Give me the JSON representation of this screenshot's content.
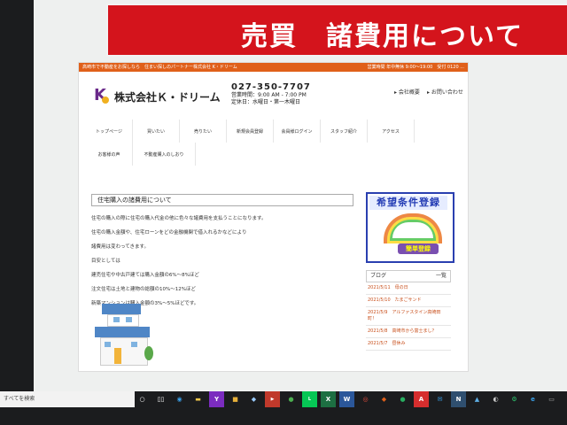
{
  "banner": {
    "title": "売買　諸費用について"
  },
  "site": {
    "topbar": {
      "left": "高崎市で不動産をお探しなら　住まい探しのパートナー株式会社 K・ドリーム",
      "right": "営業時間 年中無休 9:00～19:00　受付 0120 ..."
    },
    "company_name": "株式会社Ｋ・ドリーム",
    "logo_icon": "k-dream-logo",
    "phone": "027-350-7707",
    "hours": "営業時間：9:00 AM - 7:00 PM",
    "closed": "定休日：水曜日・第一木曜日",
    "toplinks": [
      "会社概要",
      "お問い合わせ"
    ],
    "nav": [
      [
        "トップページ",
        "買いたい",
        "売りたい",
        "新規会員登録",
        "会員様ログイン",
        "スタッフ紹介",
        "アクセス"
      ],
      [
        "お客様の声",
        "不動産購入のしおり"
      ]
    ],
    "page_title": "住宅購入の諸費用について",
    "paragraphs": [
      "住宅の購入の際に住宅の購入代金の他に色々な諸費用を支払うことになります。",
      "住宅の購入金額や、住宅ローンをどの金融機関で借入れるかなどにより",
      "諸費用は変わってきます。",
      "目安としては",
      "建売住宅や中古戸建ては購入金額の6%～8%ほど",
      "注文住宅は土地と建物の総額の10%～12%ほど",
      "新築マンションは購入金額の3%～5%ほどです。"
    ],
    "sidebar": {
      "reg_title": "希望条件登録",
      "reg_easy": "簡単登録",
      "blog_label": "ブログ",
      "blog_more": "一覧",
      "blog_items": [
        {
          "date": "2021/5/11",
          "title": "母の日"
        },
        {
          "date": "2021/5/10",
          "title": "たまごサンド"
        },
        {
          "date": "2021/5/9",
          "title": "アルファスタイン高崎田町！"
        },
        {
          "date": "2021/5/8",
          "title": "高崎市から富士まし？"
        },
        {
          "date": "2021/5/7",
          "title": "昼休み"
        }
      ]
    }
  },
  "taskbar": {
    "search_placeholder": "すべてを検索",
    "icons": [
      "search-icon",
      "task-view-icon",
      "edge-icon",
      "folder-icon",
      "yahoo-icon",
      "app-icon",
      "store-icon",
      "media-icon",
      "contacts-icon",
      "line-icon",
      "excel-icon",
      "word-icon",
      "chrome-icon",
      "app2-icon",
      "app3-icon",
      "acrobat-icon",
      "mail-icon",
      "app4-icon",
      "photos-icon",
      "camera-icon",
      "settings-icon",
      "edge-icon",
      "app5-icon"
    ]
  },
  "colors": {
    "banner_red": "#d4141c",
    "topbar_orange": "#e0601a",
    "reg_blue": "#2a3fb0"
  }
}
